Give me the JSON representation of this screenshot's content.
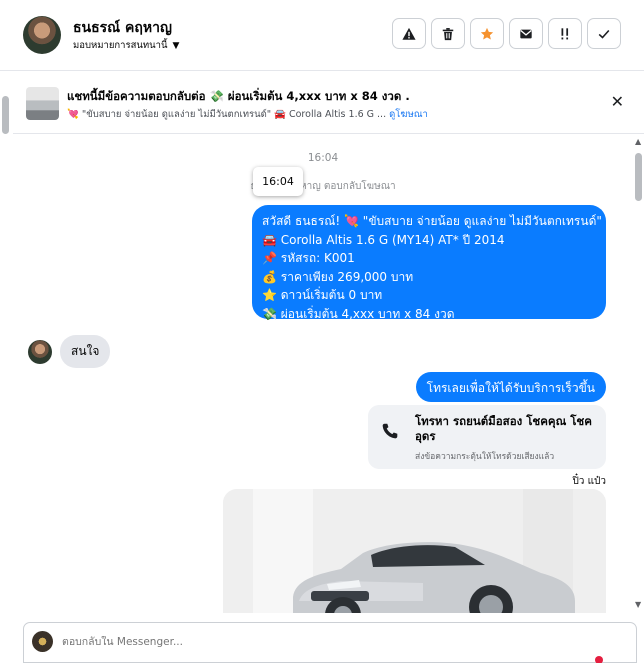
{
  "header": {
    "name": "ธนธรณ์ คฤหาญ",
    "assign_label": "มอบหมายการสนทนานี้",
    "toolbar": [
      {
        "icon": "warning-icon",
        "glyph": "⚠"
      },
      {
        "icon": "trash-icon",
        "glyph": "🗑"
      },
      {
        "icon": "star-icon",
        "glyph": "★"
      },
      {
        "icon": "envelope-icon",
        "glyph": "✉"
      },
      {
        "icon": "priority-icon",
        "glyph": "‼"
      },
      {
        "icon": "check-icon",
        "glyph": "✓"
      }
    ]
  },
  "ad": {
    "title": "แชทนี้มีข้อความตอบกลับต่อ 💸 ผ่อนเริ่มต้น 4,xxx บาท x 84 งวด .",
    "subtitle": "💘 \"ขับสบาย จ่ายน้อย ดูแลง่าย ไม่มีวันตกเทรนด์\" 🚘 Corolla Altis 1.6 G ...",
    "link": "ดูโฆษณา"
  },
  "thread": {
    "timestamp": "16:04",
    "tooltip": "16:04",
    "reply_note": "ธนธรณ์ คฤหาญ ตอบกลับโฆษณา",
    "ad_message_lines": [
      "สวัสดี ธนธรณ์! 💘 \"ขับสบาย จ่ายน้อย ดูแลง่าย ไม่มีวันตกเทรนด์\"",
      "🚘 Corolla Altis 1.6 G (MY14) AT* ปี 2014",
      "📌 รหัสรถ: K001",
      "💰 ราคาเพียง 269,000 บาท",
      "⭐ ดาวน์เริ่มต้น 0 บาท",
      "💸 ผ่อนเริ่มต้น 4,xxx บาท x 84 งวด"
    ],
    "incoming_message": "สนใจ",
    "call_prompt": "โทรเลยเพื่อให้ได้รับบริการเร็วขึ้น",
    "call_card_title": "โทรหา รถยนต์มือสอง โชคคุณ โชค อุดร",
    "call_card_subtitle": "ส่งข้อความกระตุ้นให้โทรด้วยเสียงแล้ว",
    "seen_label": "ปิ๋ว แป๋ว"
  },
  "composer": {
    "placeholder": "ตอบกลับใน Messenger..."
  }
}
